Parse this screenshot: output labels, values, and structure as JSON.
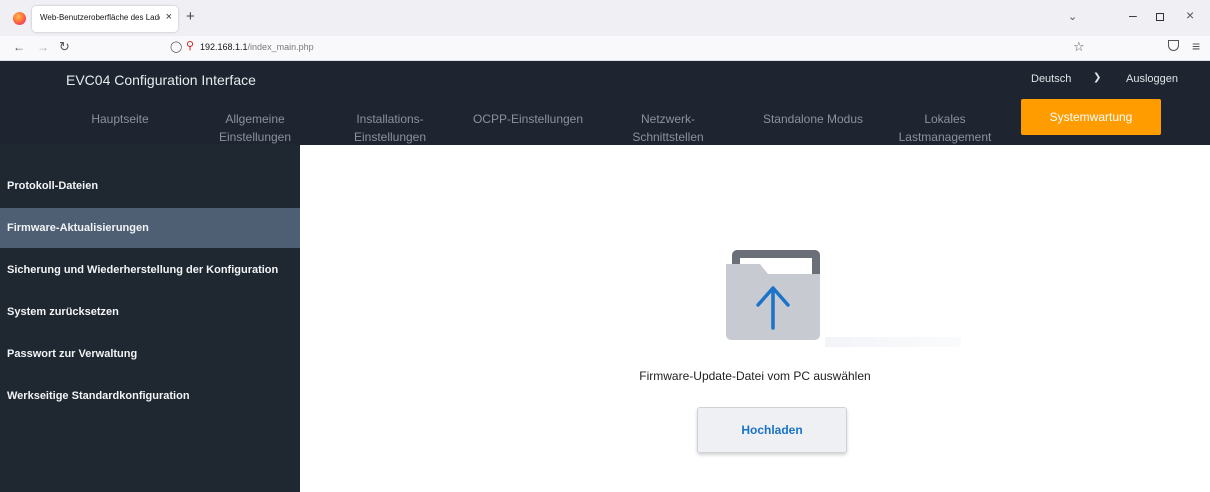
{
  "browser": {
    "tab_title": "Web-Benutzeroberfläche des Ladeg",
    "tab_close": "×",
    "new_tab": "+",
    "url_host": "192.168.1.1",
    "url_path": "/index_main.php"
  },
  "header": {
    "title": "EVC04 Configuration Interface",
    "language": "Deutsch",
    "logout": "Ausloggen"
  },
  "menu": [
    {
      "line1": "Hauptseite",
      "line2": ""
    },
    {
      "line1": "Allgemeine",
      "line2": "Einstellungen"
    },
    {
      "line1": "Installations-",
      "line2": "Einstellungen"
    },
    {
      "line1": "OCPP-Einstellungen",
      "line2": ""
    },
    {
      "line1": "Netzwerk-",
      "line2": "Schnittstellen"
    },
    {
      "line1": "Standalone Modus",
      "line2": ""
    },
    {
      "line1": "Lokales",
      "line2": "Lastmanagement"
    },
    {
      "line1": "Systemwartung",
      "line2": ""
    }
  ],
  "menu_active_index": 7,
  "sidebar": {
    "items": [
      "Protokoll-Dateien",
      "Firmware-Aktualisierungen",
      "Sicherung und Wiederherstellung der Konfiguration",
      "System zurücksetzen",
      "Passwort zur Verwaltung",
      "Werkseitige Standardkonfiguration"
    ],
    "active_index": 1
  },
  "main": {
    "upload_label": "Firmware-Update-Datei vom PC auswählen",
    "upload_button": "Hochladen",
    "icon": "folder-upload-icon"
  },
  "colors": {
    "header_bg": "#1e2530",
    "sidebar_bg": "#1f2731",
    "sidebar_active": "#4e5e73",
    "accent": "#ff9c00",
    "button_text": "#1a73c8"
  }
}
